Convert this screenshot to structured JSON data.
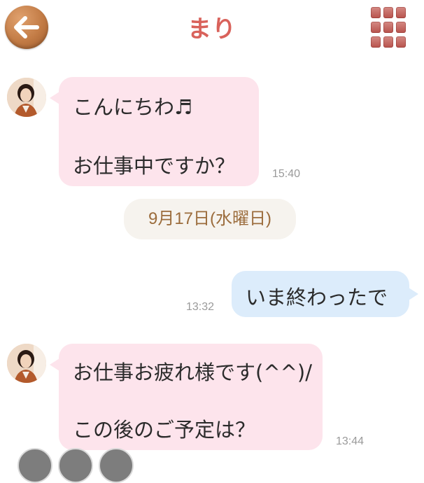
{
  "header": {
    "title": "まり",
    "back_icon": "arrow-left-icon",
    "menu_icon": "grid-menu-icon"
  },
  "messages": [
    {
      "direction": "incoming",
      "lines": [
        "こんにちわ♬",
        "お仕事中ですか？"
      ],
      "time": "15:40"
    },
    {
      "direction": "outgoing",
      "lines": [
        "いま終わったで"
      ],
      "time": "13:32"
    },
    {
      "direction": "incoming",
      "lines": [
        "お仕事お疲れ様です(^^)/",
        "この後のご予定は？"
      ],
      "time": "13:44"
    }
  ],
  "date_separator": "9月17日(水曜日)",
  "colors": {
    "title": "#d9625b",
    "incoming_bubble": "#fde4ec",
    "outgoing_bubble": "#dcecfb",
    "date_text": "#9b6c3c"
  }
}
